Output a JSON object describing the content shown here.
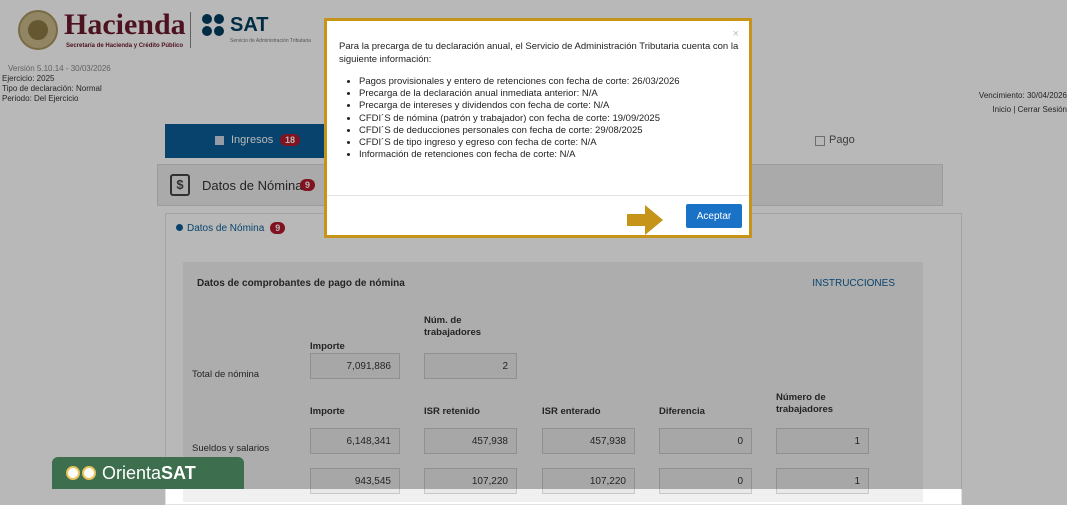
{
  "header": {
    "hacienda_title": "Hacienda",
    "hacienda_sub": "Secretaría de Hacienda y Crédito Público",
    "sat_title": "SAT",
    "sat_sub": "Servicio de Administración Tributaria"
  },
  "info": {
    "version": "Versión 5.10.14 - 30/03/2026",
    "ejercicio": "Ejercicio: 2025",
    "tipo": "Tipo de declaración: Normal",
    "periodo": "Periodo: Del Ejercicio",
    "vencimiento": "Vencimiento: 30/04/2026",
    "links": "Inicio | Cerrar Sesión"
  },
  "tabs": {
    "ingresos": "Ingresos",
    "ingresos_count": "18",
    "pago": "Pago"
  },
  "section": {
    "title": "Datos de Nómina",
    "count": "9",
    "sub_title": "Datos de Nómina",
    "sub_count": "9"
  },
  "panel": {
    "title": "Datos de comprobantes de pago de nómina",
    "instrucciones": "INSTRUCCIONES",
    "col_importe": "Importe",
    "col_num_trab": "Núm. de trabajadores",
    "total_label": "Total de nómina",
    "total_importe": "7,091,886",
    "total_num": "2",
    "h_importe": "Importe",
    "h_isr_ret": "ISR retenido",
    "h_isr_ent": "ISR enterado",
    "h_dif": "Diferencia",
    "h_num": "Número de trabajadores",
    "row1_label": "Sueldos y salarios",
    "row1": [
      "6,148,341",
      "457,938",
      "457,938",
      "0",
      "1"
    ],
    "row2": [
      "943,545",
      "107,220",
      "107,220",
      "0",
      "1"
    ]
  },
  "modal": {
    "intro": "Para la precarga de tu declaración anual, el Servicio de Administración Tributaria cuenta con la siguiente información:",
    "items": [
      "Pagos provisionales y entero de retenciones con fecha de corte: 26/03/2026",
      "Precarga de la declaración anual inmediata anterior: N/A",
      "Precarga de intereses y dividendos con fecha de corte: N/A",
      "CFDI´S de nómina (patrón y trabajador) con fecha de corte: 19/09/2025",
      "CFDI´S de deducciones personales con fecha de corte: 29/08/2025",
      "CFDI´S de tipo ingreso y egreso con fecha de corte: N/A",
      "Información de retenciones con fecha de corte: N/A"
    ],
    "close": "×",
    "accept": "Aceptar",
    "arrow_color": "#c59418"
  },
  "orienta": {
    "prefix": "Orienta",
    "suffix": "SAT"
  }
}
